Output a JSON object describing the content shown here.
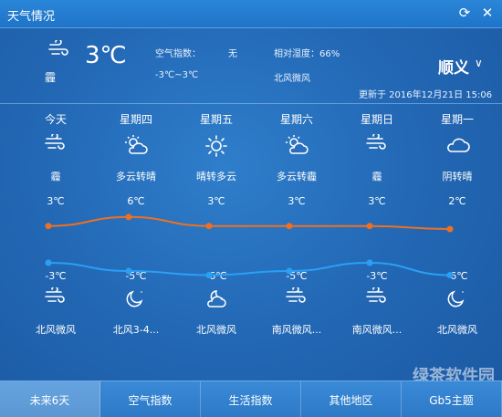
{
  "window": {
    "title": "天气情况"
  },
  "current": {
    "condition": "霾",
    "temp": "3℃",
    "aqi_label": "空气指数：",
    "aqi_value": "无",
    "humidity": "相对湿度：66%",
    "range": "-3℃~3℃",
    "wind": "北风微风",
    "city": "顺义",
    "updated": "更新于 2016年12月21日 15:06"
  },
  "forecast": [
    {
      "day": "今天",
      "day_icon": "haze-icon",
      "condition": "霾",
      "high": "3℃",
      "low": "-3℃",
      "night_icon": "haze-icon",
      "wind": "北风微风"
    },
    {
      "day": "星期四",
      "day_icon": "partly-cloudy-icon",
      "condition": "多云转晴",
      "high": "6℃",
      "low": "-5℃",
      "night_icon": "moon-icon",
      "wind": "北风3-4..."
    },
    {
      "day": "星期五",
      "day_icon": "sun-icon",
      "condition": "晴转多云",
      "high": "3℃",
      "low": "-6℃",
      "night_icon": "cloudy-night-icon",
      "wind": "北风微风"
    },
    {
      "day": "星期六",
      "day_icon": "partly-cloudy-icon",
      "condition": "多云转霾",
      "high": "3℃",
      "low": "-5℃",
      "night_icon": "haze-icon",
      "wind": "南风微风..."
    },
    {
      "day": "星期日",
      "day_icon": "haze-icon",
      "condition": "霾",
      "high": "3℃",
      "low": "-3℃",
      "night_icon": "haze-icon",
      "wind": "南风微风..."
    },
    {
      "day": "星期一",
      "day_icon": "cloud-icon",
      "condition": "阴转晴",
      "high": "2℃",
      "low": "-6℃",
      "night_icon": "moon-icon",
      "wind": "北风微风"
    }
  ],
  "chart_data": {
    "type": "line",
    "categories": [
      "今天",
      "星期四",
      "星期五",
      "星期六",
      "星期日",
      "星期一"
    ],
    "series": [
      {
        "values": [
          3,
          6,
          3,
          3,
          3,
          2
        ],
        "color": "#f07020"
      },
      {
        "values": [
          -3,
          -5,
          -6,
          -5,
          -3,
          -6
        ],
        "color": "#2aa0f5"
      }
    ]
  },
  "tabs": [
    "未来6天",
    "空气指数",
    "生活指数",
    "其他地区",
    "Gb5主题"
  ],
  "watermark": "绿茶软件园",
  "colors": {
    "accent": "#2369b6",
    "high_line": "#f07020",
    "low_line": "#2aa0f5"
  }
}
